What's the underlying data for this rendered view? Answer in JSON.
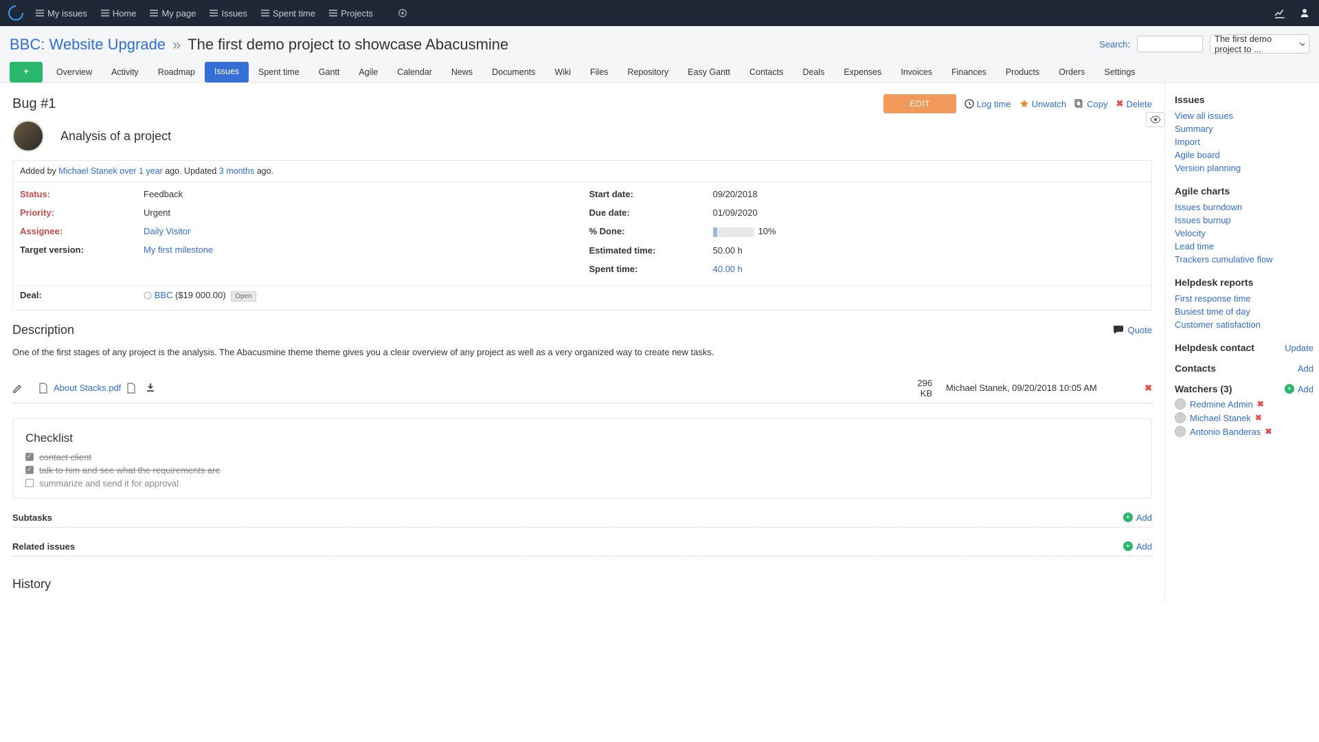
{
  "topnav": {
    "items": [
      "My issues",
      "Home",
      "My page",
      "Issues",
      "Spent time",
      "Projects"
    ]
  },
  "breadcrumb": {
    "project": "BBC: Website Upgrade",
    "sep": "»",
    "page": "The first demo project to showcase Abacusmine"
  },
  "search": {
    "label": "Search",
    "project_selected": "The first demo project to ..."
  },
  "tabs": [
    "Overview",
    "Activity",
    "Roadmap",
    "Issues",
    "Spent time",
    "Gantt",
    "Agile",
    "Calendar",
    "News",
    "Documents",
    "Wiki",
    "Files",
    "Repository",
    "Easy Gantt",
    "Contacts",
    "Deals",
    "Expenses",
    "Invoices",
    "Finances",
    "Products",
    "Orders",
    "Settings"
  ],
  "active_tab": "Issues",
  "issue": {
    "id": "Bug #1",
    "title": "Analysis of a project",
    "added_by": "Michael Stanek",
    "added_ago": "over 1 year",
    "updated_ago": "3 months",
    "added_prefix": "Added by ",
    "updated_prefix": " ago. Updated ",
    "suffix_ago": " ago.",
    "edit": "EDIT",
    "actions": {
      "logtime": "Log time",
      "unwatch": "Unwatch",
      "copy": "Copy",
      "delete": "Delete"
    }
  },
  "attrs_left": {
    "status": {
      "k": "Status:",
      "v": "Feedback",
      "req": true
    },
    "priority": {
      "k": "Priority:",
      "v": "Urgent",
      "req": true
    },
    "assignee": {
      "k": "Assignee:",
      "v": "Daily Visitor",
      "req": true,
      "link": true
    },
    "target": {
      "k": "Target version:",
      "v": "My first milestone",
      "link": true
    }
  },
  "attrs_right": {
    "start": {
      "k": "Start date:",
      "v": "09/20/2018"
    },
    "due": {
      "k": "Due date:",
      "v": "01/09/2020"
    },
    "done": {
      "k": "% Done:",
      "pct": 10,
      "v": "10%"
    },
    "est": {
      "k": "Estimated time:",
      "v": "50.00 h"
    },
    "spent": {
      "k": "Spent time:",
      "v": "40.00 h",
      "link": true
    }
  },
  "deal": {
    "k": "Deal:",
    "name": "BBC",
    "amount": "($19 000.00)",
    "badge": "Open"
  },
  "description": {
    "heading": "Description",
    "quote": "Quote",
    "body": "One of the first stages of any project is the analysis. The Abacusmine theme theme gives you a clear overview of any project as well as a very organized way to create new tasks."
  },
  "attachment": {
    "name": "About Stacks.pdf",
    "size": "296 KB",
    "author": "Michael Stanek, 09/20/2018 10:05 AM"
  },
  "checklist": {
    "heading": "Checklist",
    "items": [
      {
        "label": "contact client",
        "done": true
      },
      {
        "label": "talk to him and see what the requirements are",
        "done": true
      },
      {
        "label": "summarize and send it for approval",
        "done": false
      }
    ]
  },
  "subtasks": {
    "title": "Subtasks",
    "add": "Add"
  },
  "related": {
    "title": "Related issues",
    "add": "Add"
  },
  "history": "History",
  "sidebar": {
    "issues": {
      "h": "Issues",
      "links": [
        "View all issues",
        "Summary",
        "Import",
        "Agile board",
        "Version planning"
      ]
    },
    "agile": {
      "h": "Agile charts",
      "links": [
        "Issues burndown",
        "Issues burnup",
        "Velocity",
        "Lead time",
        "Trackers cumulative flow"
      ]
    },
    "helpdesk": {
      "h": "Helpdesk reports",
      "links": [
        "First response time",
        "Busiest time of day",
        "Customer satisfaction"
      ]
    },
    "hcontact": {
      "h": "Helpdesk contact",
      "action": "Update"
    },
    "contacts": {
      "h": "Contacts",
      "action": "Add"
    },
    "watchers": {
      "h": "Watchers (3)",
      "action": "Add",
      "list": [
        "Redmine Admin",
        "Michael Stanek",
        "Antonio Banderas"
      ]
    }
  }
}
